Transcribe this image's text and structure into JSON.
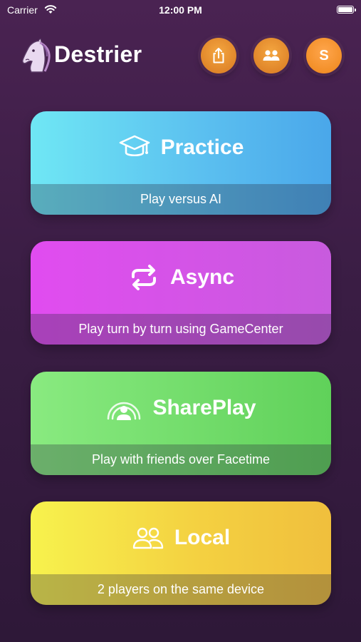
{
  "status_bar": {
    "carrier": "Carrier",
    "time": "12:00 PM"
  },
  "header": {
    "app_title": "Destrier",
    "logo_icon": "horse-head-logo",
    "buttons": [
      {
        "name": "share-button",
        "icon": "share-icon"
      },
      {
        "name": "friends-button",
        "icon": "people-icon"
      },
      {
        "name": "profile-button",
        "label": "S"
      }
    ],
    "accent_color": "#f0922c"
  },
  "modes": [
    {
      "title": "Practice",
      "subtitle": "Play versus AI",
      "icon": "graduation-cap-icon",
      "color": "#5cc1f0"
    },
    {
      "title": "Async",
      "subtitle": "Play turn by turn using GameCenter",
      "icon": "repeat-arrows-icon",
      "color": "#d653e8"
    },
    {
      "title": "SharePlay",
      "subtitle": "Play with friends over Facetime",
      "icon": "shareplay-icon",
      "color": "#6ddc66"
    },
    {
      "title": "Local",
      "subtitle": "2 players on the same device",
      "icon": "two-people-icon",
      "color": "#f4d141"
    }
  ]
}
